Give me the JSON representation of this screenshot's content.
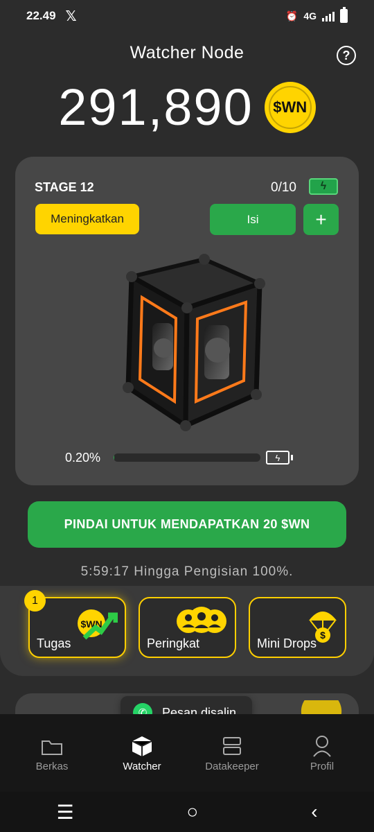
{
  "status": {
    "time": "22.49",
    "network": "4G"
  },
  "header": {
    "title": "Watcher Node"
  },
  "balance": {
    "value": "291,890",
    "coin_label": "$WN"
  },
  "stage_card": {
    "stage": "STAGE 12",
    "count": "0/10",
    "upgrade_label": "Meningkatkan",
    "refill_label": "Isi",
    "plus_label": "+",
    "progress_text": "0.20%",
    "progress_fraction": 0.002
  },
  "scan_button": {
    "label": "PINDAI UNTUK MENDAPATKAN 20 $WN"
  },
  "countdown": {
    "text": "5:59:17 Hingga Pengisian 100%."
  },
  "features": [
    {
      "label": "Tugas",
      "badge": "1",
      "coin_label": "$WN"
    },
    {
      "label": "Peringkat"
    },
    {
      "label": "Mini Drops"
    }
  ],
  "toast": {
    "text": "Pesan disalin"
  },
  "nav": [
    {
      "label": "Berkas"
    },
    {
      "label": "Watcher"
    },
    {
      "label": "Datakeeper"
    },
    {
      "label": "Profil"
    }
  ],
  "colors": {
    "accent_yellow": "#ffd400",
    "accent_green": "#2aa84a",
    "background": "#2c2c2c"
  }
}
